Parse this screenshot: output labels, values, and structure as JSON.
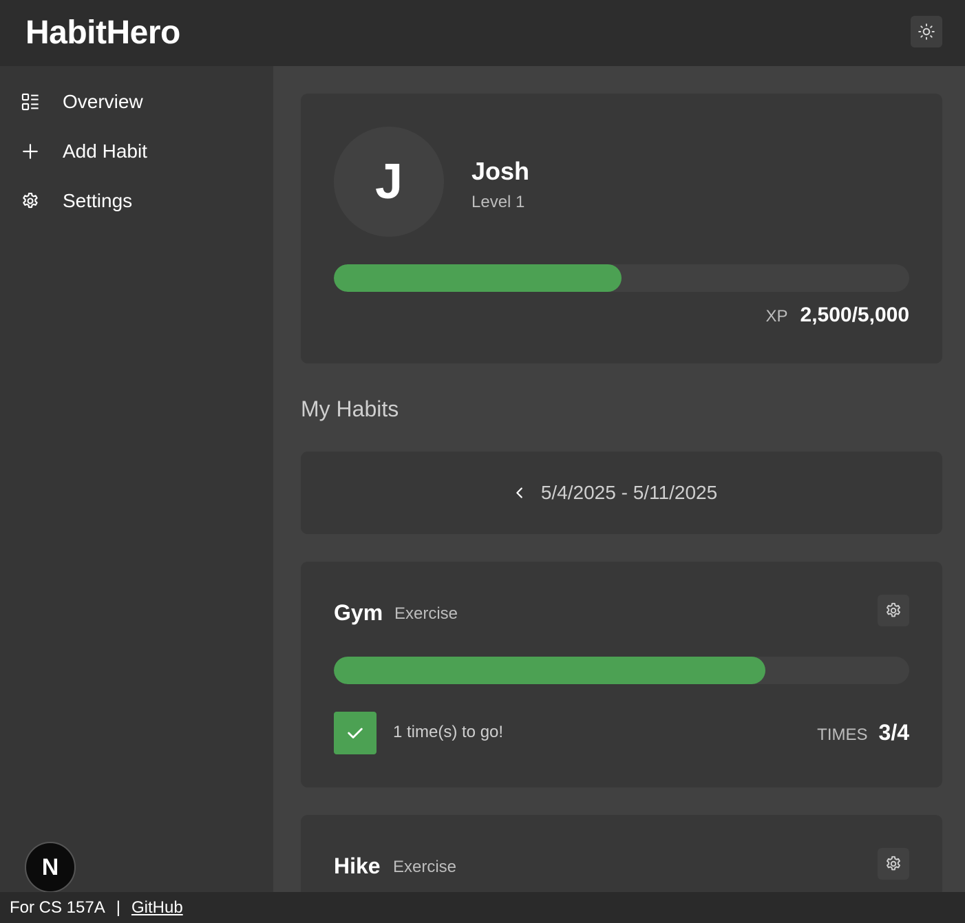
{
  "app": {
    "title": "HabitHero"
  },
  "header": {
    "theme_icon": "sun-icon"
  },
  "sidebar": {
    "items": [
      {
        "label": "Overview",
        "icon": "overview-icon"
      },
      {
        "label": "Add Habit",
        "icon": "plus-icon"
      },
      {
        "label": "Settings",
        "icon": "gear-icon"
      }
    ],
    "badge_letter": "N"
  },
  "profile": {
    "initial": "J",
    "name": "Josh",
    "level": "Level 1",
    "xp_label": "XP",
    "xp_value": "2,500/5,000",
    "xp_progress": 0.5
  },
  "habits_section": {
    "title": "My Habits",
    "date_range": "5/4/2025 - 5/11/2025"
  },
  "habits": [
    {
      "name": "Gym",
      "category": "Exercise",
      "progress": 0.75,
      "status": "1 time(s) to go!",
      "times_label": "TIMES",
      "times_value": "3/4",
      "checked": true
    },
    {
      "name": "Hike",
      "category": "Exercise"
    }
  ],
  "footer": {
    "text": "For CS 157A",
    "separator": "|",
    "link": "GitHub"
  },
  "colors": {
    "accent": "#4ca153",
    "background": "#414141",
    "card": "#383838",
    "sidebar": "#363636",
    "header": "#2d2d2d"
  }
}
